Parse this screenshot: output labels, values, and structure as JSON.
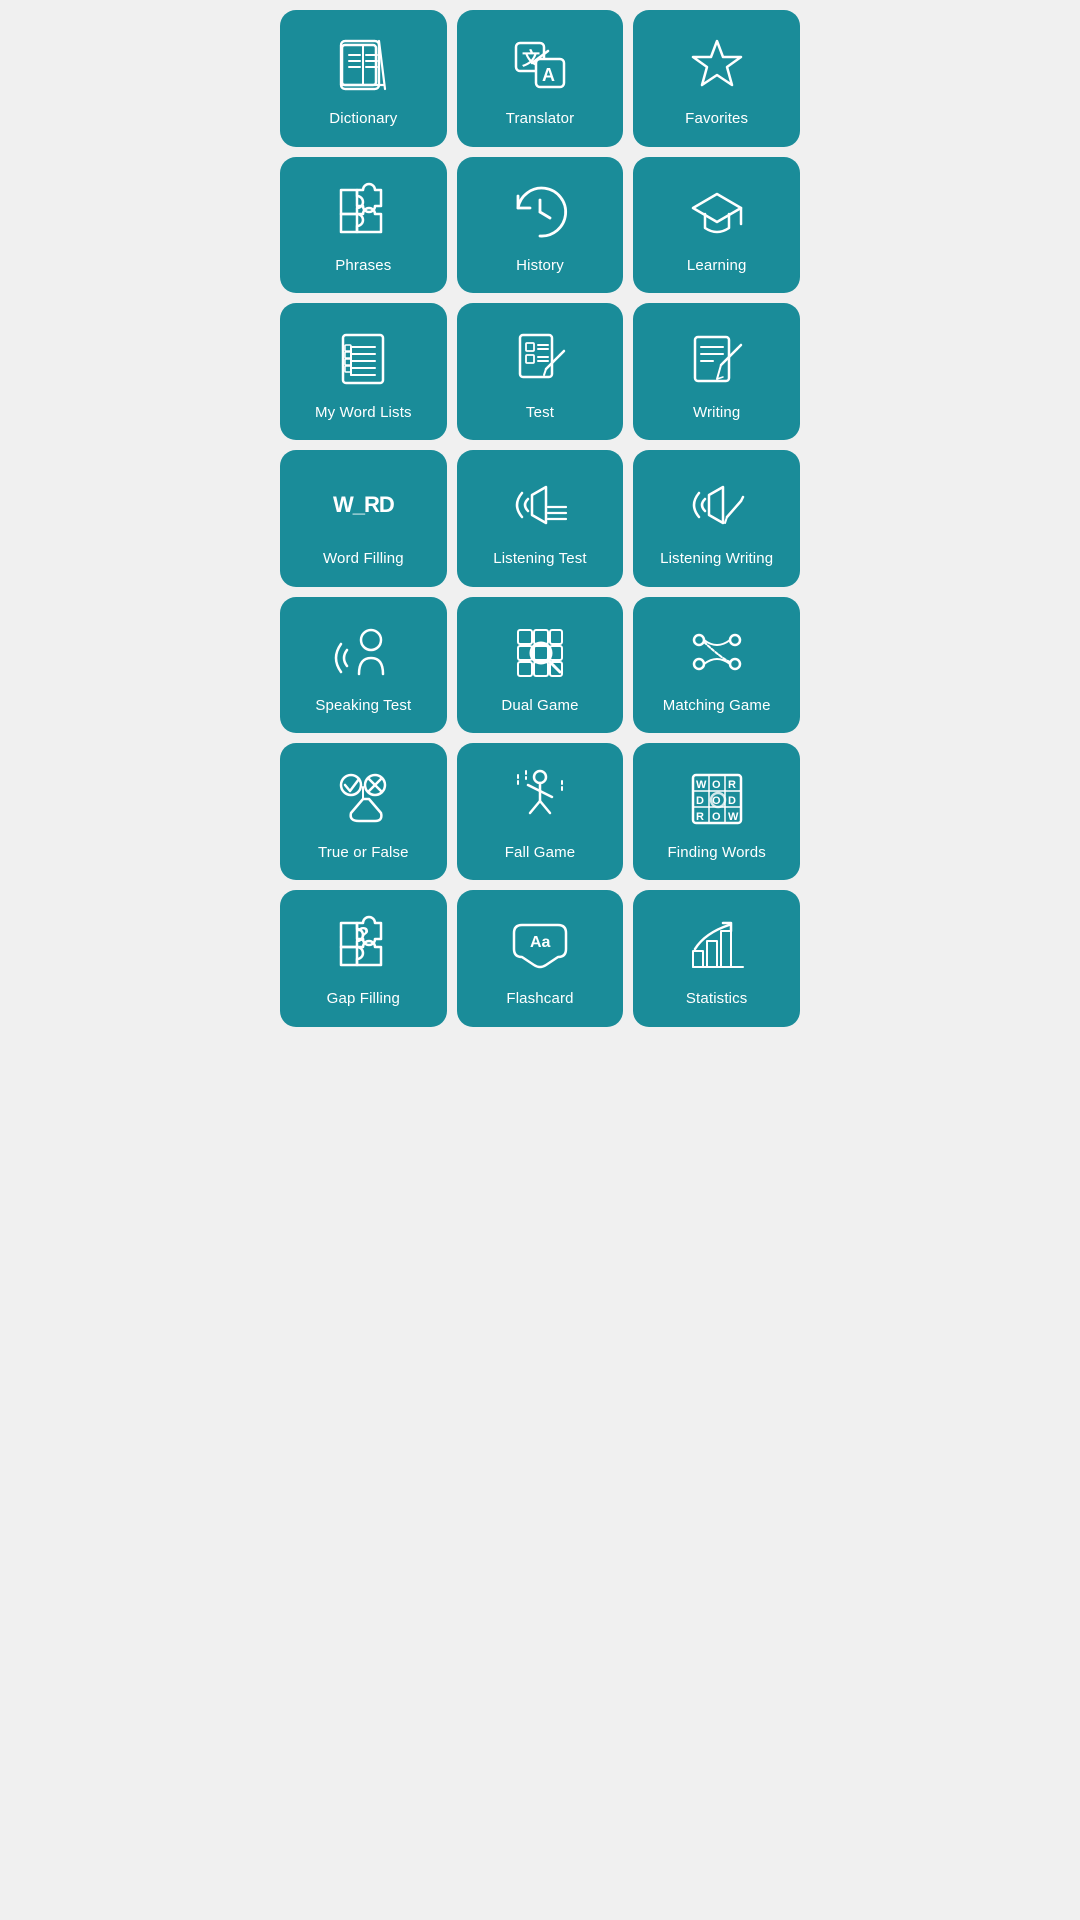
{
  "tiles": [
    {
      "id": "dictionary",
      "label": "Dictionary"
    },
    {
      "id": "translator",
      "label": "Translator"
    },
    {
      "id": "favorites",
      "label": "Favorites"
    },
    {
      "id": "phrases",
      "label": "Phrases"
    },
    {
      "id": "history",
      "label": "History"
    },
    {
      "id": "learning",
      "label": "Learning"
    },
    {
      "id": "my-word-lists",
      "label": "My Word Lists"
    },
    {
      "id": "test",
      "label": "Test"
    },
    {
      "id": "writing",
      "label": "Writing"
    },
    {
      "id": "word-filling",
      "label": "Word Filling"
    },
    {
      "id": "listening-test",
      "label": "Listening Test"
    },
    {
      "id": "listening-writing",
      "label": "Listening Writing"
    },
    {
      "id": "speaking-test",
      "label": "Speaking Test"
    },
    {
      "id": "dual-game",
      "label": "Dual Game"
    },
    {
      "id": "matching-game",
      "label": "Matching Game"
    },
    {
      "id": "true-or-false",
      "label": "True or False"
    },
    {
      "id": "fall-game",
      "label": "Fall Game"
    },
    {
      "id": "finding-words",
      "label": "Finding Words"
    },
    {
      "id": "gap-filling",
      "label": "Gap Filling"
    },
    {
      "id": "flashcard",
      "label": "Flashcard"
    },
    {
      "id": "statistics",
      "label": "Statistics"
    }
  ]
}
